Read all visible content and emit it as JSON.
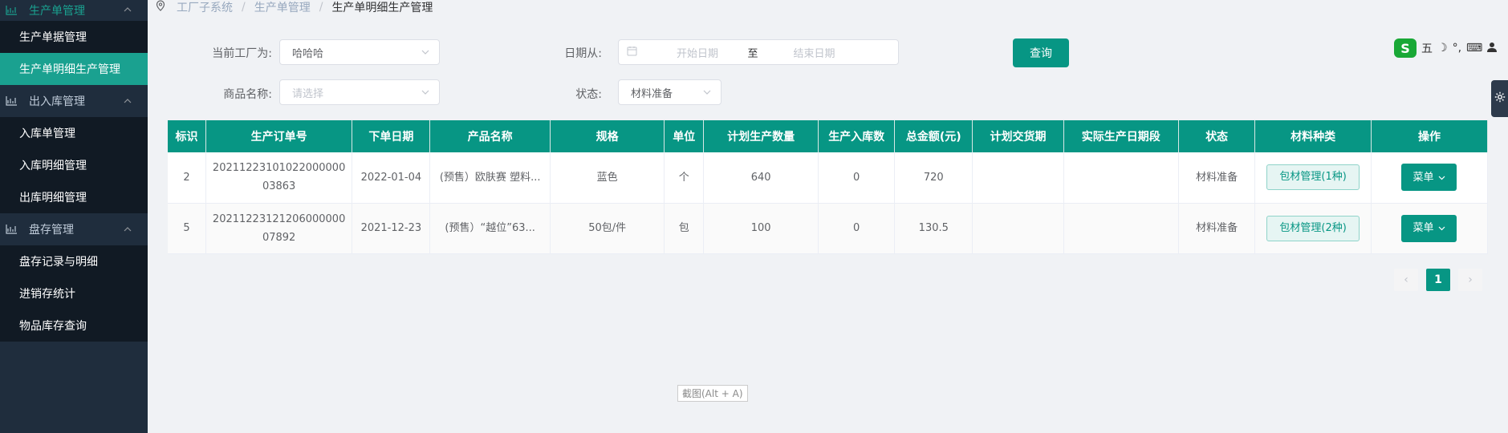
{
  "sidebar": {
    "groups": [
      {
        "label": "生产单管理",
        "items": [
          "生产单据管理",
          "生产单明细生产管理"
        ]
      },
      {
        "label": "出入库管理",
        "items": [
          "入库单管理",
          "入库明细管理",
          "出库明细管理"
        ]
      },
      {
        "label": "盘存管理",
        "items": [
          "盘存记录与明细",
          "进销存统计",
          "物品库存查询"
        ]
      }
    ]
  },
  "breadcrumb": [
    "工厂子系统",
    "生产单管理",
    "生产单明细生产管理"
  ],
  "filters": {
    "factory_label": "当前工厂为:",
    "factory_value": "哈哈哈",
    "date_label": "日期从:",
    "date_start_placeholder": "开始日期",
    "date_to": "至",
    "date_end_placeholder": "结束日期",
    "query_button": "查询",
    "product_label": "商品名称:",
    "product_placeholder": "请选择",
    "status_label": "状态:",
    "status_value": "材料准备"
  },
  "table": {
    "headers": [
      "标识",
      "生产订单号",
      "下单日期",
      "产品名称",
      "规格",
      "单位",
      "计划生产数量",
      "生产入库数",
      "总金额(元)",
      "计划交货期",
      "实际生产日期段",
      "状态",
      "材料种类",
      "操作"
    ],
    "rows": [
      {
        "id": "2",
        "order_no_1": "20211223101022000000",
        "order_no_2": "03863",
        "date": "2022-01-04",
        "product": "(预售）欧肤赛 塑料...",
        "spec": "蓝色",
        "unit": "个",
        "planned_qty": "640",
        "stocked_qty": "0",
        "amount": "720",
        "planned_delivery": "",
        "actual_period": "",
        "status": "材料准备",
        "material": "包材管理(1种)",
        "action": "菜单"
      },
      {
        "id": "5",
        "order_no_1": "20211223121206000000",
        "order_no_2": "07892",
        "date": "2021-12-23",
        "product": "(预售）“越位”63...",
        "spec": "50包/件",
        "unit": "包",
        "planned_qty": "100",
        "stocked_qty": "0",
        "amount": "130.5",
        "planned_delivery": "",
        "actual_period": "",
        "status": "材料准备",
        "material": "包材管理(2种)",
        "action": "菜单"
      }
    ]
  },
  "pagination": {
    "prev": "‹",
    "current": "1",
    "next": "›"
  },
  "tooltip": "截图(Alt + A)",
  "ime": {
    "logo": "S",
    "mode": "五",
    "moon": "☽",
    "punct": "°,",
    "keyboard": "⌨",
    "user": "👤"
  },
  "side_tab": {
    "icon": "gear-icon"
  },
  "colors": {
    "primary": "#079684",
    "sidebar": "#1f2d3d",
    "sidebar_selected": "#1aa190"
  }
}
